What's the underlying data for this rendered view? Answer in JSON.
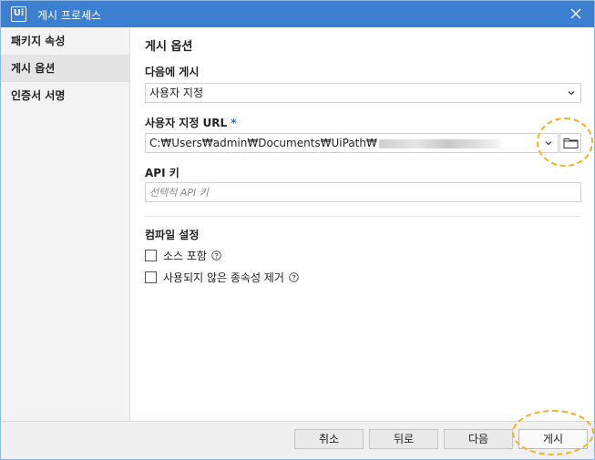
{
  "window": {
    "title": "게시 프로세스",
    "logo_text": "Ui"
  },
  "sidebar": {
    "items": [
      {
        "label": "패키지 속성"
      },
      {
        "label": "게시 옵션"
      },
      {
        "label": "인증서 서명"
      }
    ]
  },
  "main": {
    "section_title": "게시 옵션",
    "publish_to": {
      "label": "다음에 게시",
      "value": "사용자 지정"
    },
    "custom_url": {
      "label": "사용자 지정 URL",
      "required_mark": "*",
      "value": "C:₩Users₩admin₩Documents₩UiPath₩"
    },
    "api_key": {
      "label": "API 키",
      "placeholder": "선택적 API 키"
    },
    "compile": {
      "label": "컴파일 설정",
      "options": [
        {
          "label": "소스 포함",
          "checked": false
        },
        {
          "label": "사용되지 않은 종속성 제거",
          "checked": false
        }
      ]
    }
  },
  "footer": {
    "cancel_label": "취소",
    "back_label": "뒤로",
    "next_label": "다음",
    "publish_label": "게시"
  },
  "icons": {
    "title_logo": "uipath-logo-icon",
    "close": "close-icon",
    "dropdown": "chevron-down-icon",
    "browse": "folder-icon",
    "help": "help-circle-icon"
  },
  "colors": {
    "titlebar": "#3b7fd1",
    "highlight": "#f2b31c",
    "required": "#2a6fd6"
  }
}
